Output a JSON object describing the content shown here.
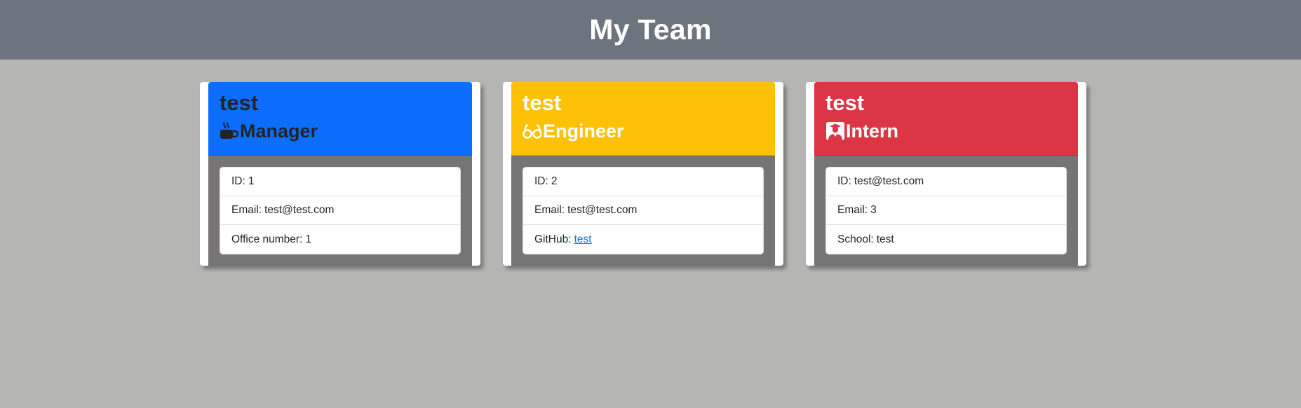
{
  "header": {
    "title": "My Team"
  },
  "cards": [
    {
      "name": "test",
      "role": "Manager",
      "icon": "coffee-icon",
      "color": "#0d6efd",
      "text_color": "#212529",
      "items": [
        {
          "label": "ID:",
          "value": "1"
        },
        {
          "label": "Email:",
          "value": "test@test.com"
        },
        {
          "label": "Office number:",
          "value": "1"
        }
      ]
    },
    {
      "name": "test",
      "role": "Engineer",
      "icon": "glasses-icon",
      "color": "#ffc107",
      "text_color": "#ffffff",
      "items": [
        {
          "label": "ID:",
          "value": "2"
        },
        {
          "label": "Email:",
          "value": "test@test.com"
        },
        {
          "label": "GitHub:",
          "value": "test"
        }
      ]
    },
    {
      "name": "test",
      "role": "Intern",
      "icon": "graduate-icon",
      "color": "#dc3545",
      "text_color": "#ffffff",
      "items": [
        {
          "label": "ID:",
          "value": "test@test.com"
        },
        {
          "label": "Email:",
          "value": "3"
        },
        {
          "label": "School:",
          "value": "test"
        }
      ]
    }
  ]
}
